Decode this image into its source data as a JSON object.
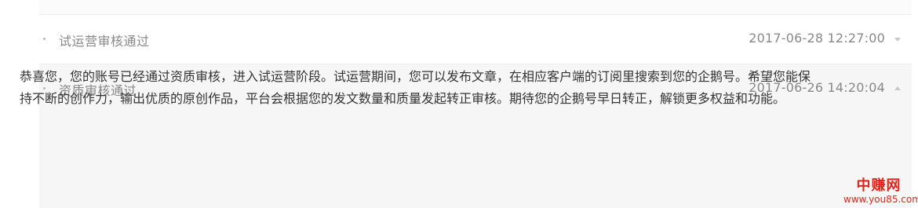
{
  "messages": [
    {
      "title": "试运营审核通过",
      "date": "2017-06-28 12:27:00",
      "expanded": false,
      "caret_icon": "chevron-down-icon"
    },
    {
      "title": "资质审核通过",
      "date": "2017-06-26 14:20:04",
      "expanded": true,
      "caret_icon": "chevron-up-icon",
      "body": "恭喜您，您的账号已经通过资质审核，进入试运营阶段。试运营期间，您可以发布文章，在相应客户端的订阅里搜索到您的企鹅号。希望您能保持不断的创作力，输出优质的原创作品，平台会根据您的发文数量和质量发起转正审核。期待您的企鹅号早日转正，解锁更多权益和功能。"
    }
  ],
  "watermark": {
    "name": "中赚网",
    "url": "www.you85.com",
    "color": "#e2231a"
  },
  "colors": {
    "muted_text": "#888888",
    "body_text": "#333333",
    "expanded_bg": "#f6f6f6"
  }
}
